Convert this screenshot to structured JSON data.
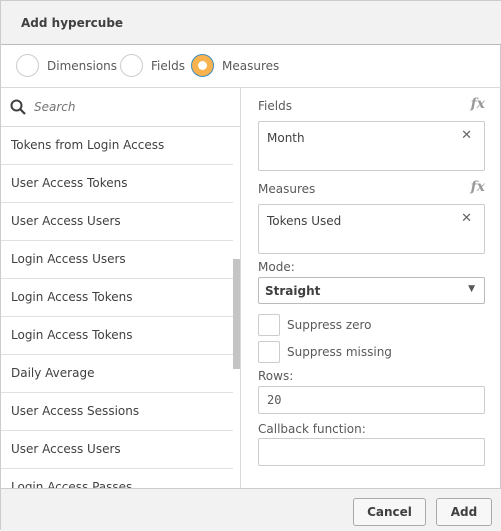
{
  "dialog": {
    "title": "Add hypercube"
  },
  "radios": [
    {
      "label": "Dimensions",
      "selected": false
    },
    {
      "label": "Fields",
      "selected": false
    },
    {
      "label": "Measures",
      "selected": true
    }
  ],
  "accent_color": "#f8b34f",
  "search": {
    "placeholder": "Search"
  },
  "list": [
    "Tokens from Login Access",
    "User Access Tokens",
    "User Access Users",
    "Login Access Users",
    "Login Access Tokens",
    "Login Access Tokens",
    "Daily Average",
    "User Access Sessions",
    "User Access Users",
    "Login Access Passes"
  ],
  "right": {
    "fields_label": "Fields",
    "fields_value": "Month",
    "measures_label": "Measures",
    "measures_value": "Tokens Used",
    "fx": "fx",
    "clear": "✕",
    "mode_label": "Mode:",
    "mode_value": "Straight",
    "suppress_zero": "Suppress zero",
    "suppress_missing": "Suppress missing",
    "rows_label": "Rows:",
    "rows_value": "20",
    "callback_label": "Callback function:",
    "callback_value": ""
  },
  "footer": {
    "cancel": "Cancel",
    "add": "Add"
  }
}
